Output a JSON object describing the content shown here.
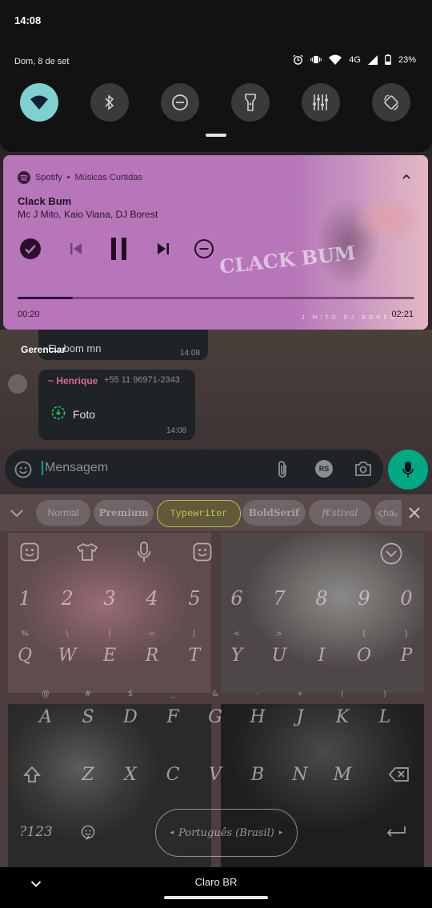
{
  "status_bar": {
    "time": "14:08",
    "date": "Dom, 8 de set",
    "network": "4G",
    "battery": "23%"
  },
  "quick_settings": [
    {
      "name": "wifi",
      "active": true
    },
    {
      "name": "bluetooth",
      "active": false
    },
    {
      "name": "do-not-disturb",
      "active": false
    },
    {
      "name": "flashlight",
      "active": false
    },
    {
      "name": "equalizer",
      "active": false
    },
    {
      "name": "auto-rotate",
      "active": false
    }
  ],
  "media": {
    "app": "Spotify",
    "playlist": "Músicas Curtidas",
    "separator": "•",
    "title": "Clack Bum",
    "artist": "Mc J Mito, Kaio Viana, DJ Borest",
    "elapsed": "00:20",
    "total": "02:21",
    "progress": 0.14,
    "album_art_text": "CLACK BUM",
    "album_credits": "J MITO    DJ BOREST",
    "accent": "#b776b9"
  },
  "notifications": {
    "manage_label": "Gerenciar"
  },
  "chat": {
    "prev_message": "E.. bom mn",
    "prev_time": "14:08",
    "sender": "~ Henrique",
    "sender_phone": "+55 11 96971-2343",
    "attachment_label": "Foto",
    "message_time": "14:08",
    "input_placeholder": "Mensagem",
    "rs_label": "RS",
    "accent": "#00a884"
  },
  "keyboard": {
    "fonts": [
      "Normal",
      "Premium",
      "Typewriter",
      "BoldSerif",
      "f€stival",
      "ςhaₒ"
    ],
    "selected_font": "Typewriter",
    "numbers": [
      "1",
      "2",
      "3",
      "4",
      "5",
      "6",
      "7",
      "8",
      "9",
      "0"
    ],
    "row_q": [
      "Q",
      "W",
      "E",
      "R",
      "T",
      "Y",
      "U",
      "I",
      "O",
      "P"
    ],
    "row_q_hints": [
      "%",
      "\\",
      "|",
      "=",
      "[",
      "<",
      ">",
      "{",
      "}"
    ],
    "row_a": [
      "A",
      "S",
      "D",
      "F",
      "G",
      "H",
      "J",
      "K",
      "L"
    ],
    "row_a_hints": [
      "@",
      "#",
      "$",
      "_",
      "&",
      "-",
      "+",
      "(",
      ")"
    ],
    "row_z": [
      "Z",
      "X",
      "C",
      "V",
      "B",
      "N",
      "M"
    ],
    "symbols_key": "?123",
    "comma": ",",
    "space_label": "Português (Brasil)"
  },
  "nav": {
    "carrier": "Claro BR"
  }
}
